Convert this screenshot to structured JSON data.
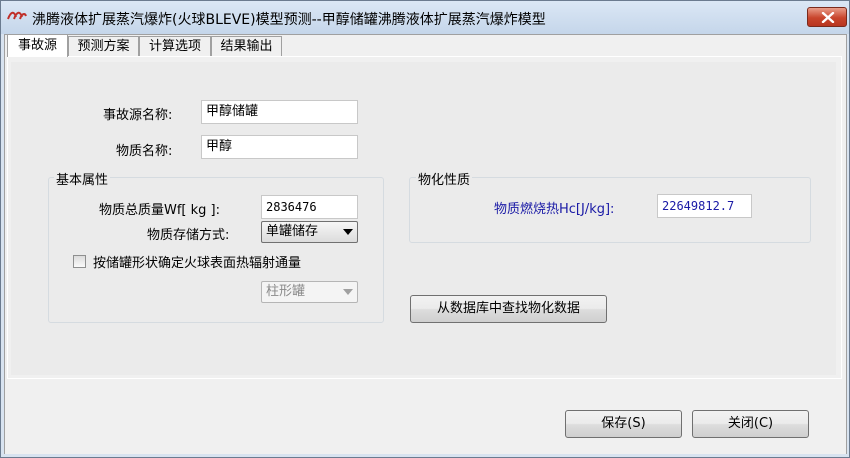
{
  "window": {
    "title": "沸腾液体扩展蒸汽爆炸(火球BLEVE)模型预测--甲醇储罐沸腾液体扩展蒸汽爆炸模型",
    "icon": "app-logo-icon"
  },
  "tabs": [
    {
      "label": "事故源",
      "active": true
    },
    {
      "label": "预测方案",
      "active": false
    },
    {
      "label": "计算选项",
      "active": false
    },
    {
      "label": "结果输出",
      "active": false
    }
  ],
  "form": {
    "source_name_label": "事故源名称:",
    "source_name_value": "甲醇储罐",
    "material_name_label": "物质名称:",
    "material_name_value": "甲醇"
  },
  "basic_props": {
    "title": "基本属性",
    "total_mass_label": "物质总质量Wf[ kg ]:",
    "total_mass_value": "2836476",
    "storage_mode_label": "物质存储方式:",
    "storage_mode_value": "单罐储存",
    "checkbox_label": "按储罐形状确定火球表面热辐射通量",
    "checkbox_checked": false,
    "tank_shape_value": "柱形罐"
  },
  "physchem": {
    "title": "物化性质",
    "heat_label": "物质燃烧热Hc[J/kg]:",
    "heat_value": "22649812.7",
    "lookup_button": "从数据库中查找物化数据"
  },
  "buttons": {
    "save": "保存(S)",
    "close": "关闭(C)"
  },
  "colors": {
    "accent_text": "#1a1aa6",
    "close_button": "#c8452c"
  }
}
